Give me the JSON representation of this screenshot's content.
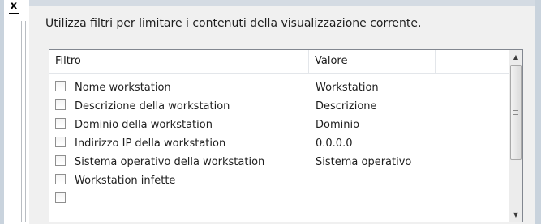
{
  "toolbar": {
    "close_label": "x"
  },
  "description": "Utilizza filtri per limitare i contenuti della visualizzazione corrente.",
  "grid": {
    "columns": [
      "Filtro",
      "Valore",
      ""
    ],
    "rows": [
      {
        "label": "Nome workstation",
        "value": "Workstation",
        "checked": false
      },
      {
        "label": "Descrizione della workstation",
        "value": "Descrizione",
        "checked": false
      },
      {
        "label": "Dominio della workstation",
        "value": "Dominio",
        "checked": false
      },
      {
        "label": "Indirizzo IP della workstation",
        "value": "0.0.0.0",
        "checked": false
      },
      {
        "label": "Sistema operativo della workstation",
        "value": "Sistema operativo",
        "checked": false
      },
      {
        "label": "Workstation infette",
        "value": "",
        "checked": false
      },
      {
        "label": "",
        "value": "",
        "checked": false
      }
    ]
  },
  "scrollbar": {
    "up_icon": "arrow-up-icon",
    "down_icon": "arrow-down-icon"
  },
  "colors": {
    "frame": "#c9d3dd",
    "panel": "#f0f0f0",
    "grid_border": "#828790"
  }
}
